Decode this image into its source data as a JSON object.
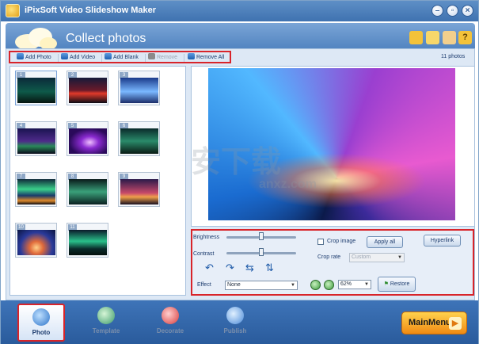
{
  "window": {
    "title": "iPixSoft Video Slideshow Maker",
    "minimize": "–",
    "restore": "▫",
    "close": "×"
  },
  "header": {
    "title": "Collect photos",
    "icons": [
      "folder-icon",
      "gift-icon",
      "person-icon",
      "help-icon"
    ],
    "help_glyph": "?"
  },
  "toolbar": {
    "add_photo": "Add Photo",
    "add_video": "Add Video",
    "add_blank": "Add Blank",
    "remove": "Remove",
    "remove_all": "Remove All",
    "photo_count": "11 photos"
  },
  "thumbnails": [
    {
      "num": "1",
      "selected": true
    },
    {
      "num": "2"
    },
    {
      "num": "3"
    },
    {
      "num": "4"
    },
    {
      "num": "5"
    },
    {
      "num": "6"
    },
    {
      "num": "7"
    },
    {
      "num": "8"
    },
    {
      "num": "9"
    },
    {
      "num": "10"
    },
    {
      "num": "11"
    }
  ],
  "controls": {
    "brightness_label": "Brightness",
    "contrast_label": "Contrast",
    "brightness_level": 0.5,
    "contrast_level": 0.5,
    "crop_image_label": "Crop image",
    "apply_all_label": "Apply all",
    "crop_rate_label": "Crop rate",
    "crop_rate_value": "Custom",
    "hyperlink_label": "Hyperlink",
    "effect_label": "Effect",
    "effect_value": "None",
    "zoom_value": "62%",
    "restore_label": "Restore"
  },
  "nav": {
    "photo": "Photo",
    "template": "Template",
    "decorate": "Decorate",
    "publish": "Publish",
    "main_menu": "MainMenu",
    "active": "photo"
  },
  "watermark": {
    "line1": "安下载",
    "line2": "anxz.com"
  },
  "colors": {
    "highlight": "#d8242a",
    "accent": "#3e74b8"
  }
}
